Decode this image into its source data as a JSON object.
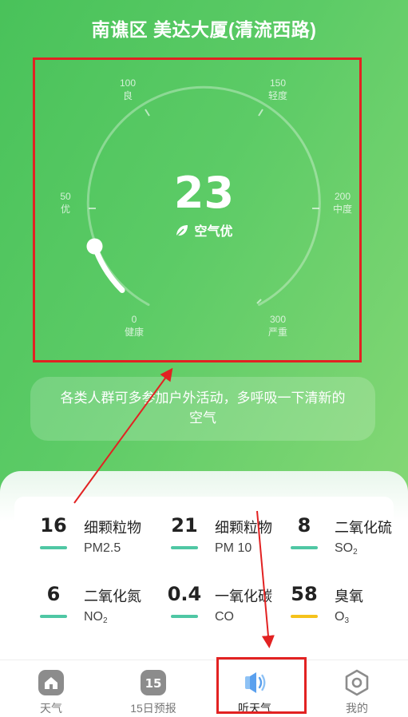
{
  "header": {
    "location": "南谯区 美达大厦(清流西路)"
  },
  "gauge": {
    "value": "23",
    "level_label": "空气优",
    "scale_max": 300,
    "fill_value": 23,
    "ticks": [
      {
        "value": "0",
        "label": "健康"
      },
      {
        "value": "50",
        "label": "优"
      },
      {
        "value": "100",
        "label": "良"
      },
      {
        "value": "150",
        "label": "轻度"
      },
      {
        "value": "200",
        "label": "中度"
      },
      {
        "value": "300",
        "label": "严重"
      }
    ]
  },
  "advice": {
    "text": "各类人群可多参加户外活动，多呼吸一下清新的空气"
  },
  "pollutants": [
    {
      "value": "16",
      "name": "细颗粒物",
      "code": "PM2.5",
      "sub": "",
      "bar_color": "#4fc7a4"
    },
    {
      "value": "21",
      "name": "细颗粒物",
      "code": "PM 10",
      "sub": "",
      "bar_color": "#4fc7a4"
    },
    {
      "value": "8",
      "name": "二氧化硫",
      "code": "SO",
      "sub": "2",
      "bar_color": "#4fc7a4"
    },
    {
      "value": "6",
      "name": "二氧化氮",
      "code": "NO",
      "sub": "2",
      "bar_color": "#4fc7a4"
    },
    {
      "value": "0.4",
      "name": "一氧化碳",
      "code": "CO",
      "sub": "",
      "bar_color": "#4fc7a4"
    },
    {
      "value": "58",
      "name": "臭氧",
      "code": "O",
      "sub": "3",
      "bar_color": "#f5c21b"
    }
  ],
  "tabs": [
    {
      "label": "天气",
      "icon": "home-icon"
    },
    {
      "label": "15日预报",
      "icon": "calendar-15-icon",
      "badge": "15"
    },
    {
      "label": "听天气",
      "icon": "speaker-icon"
    },
    {
      "label": "我的",
      "icon": "hexagon-profile-icon"
    }
  ],
  "colors": {
    "accent_green": "#5ccb66",
    "annotation_red": "#e22222",
    "tab_active_blue": "#5aa0ee"
  }
}
